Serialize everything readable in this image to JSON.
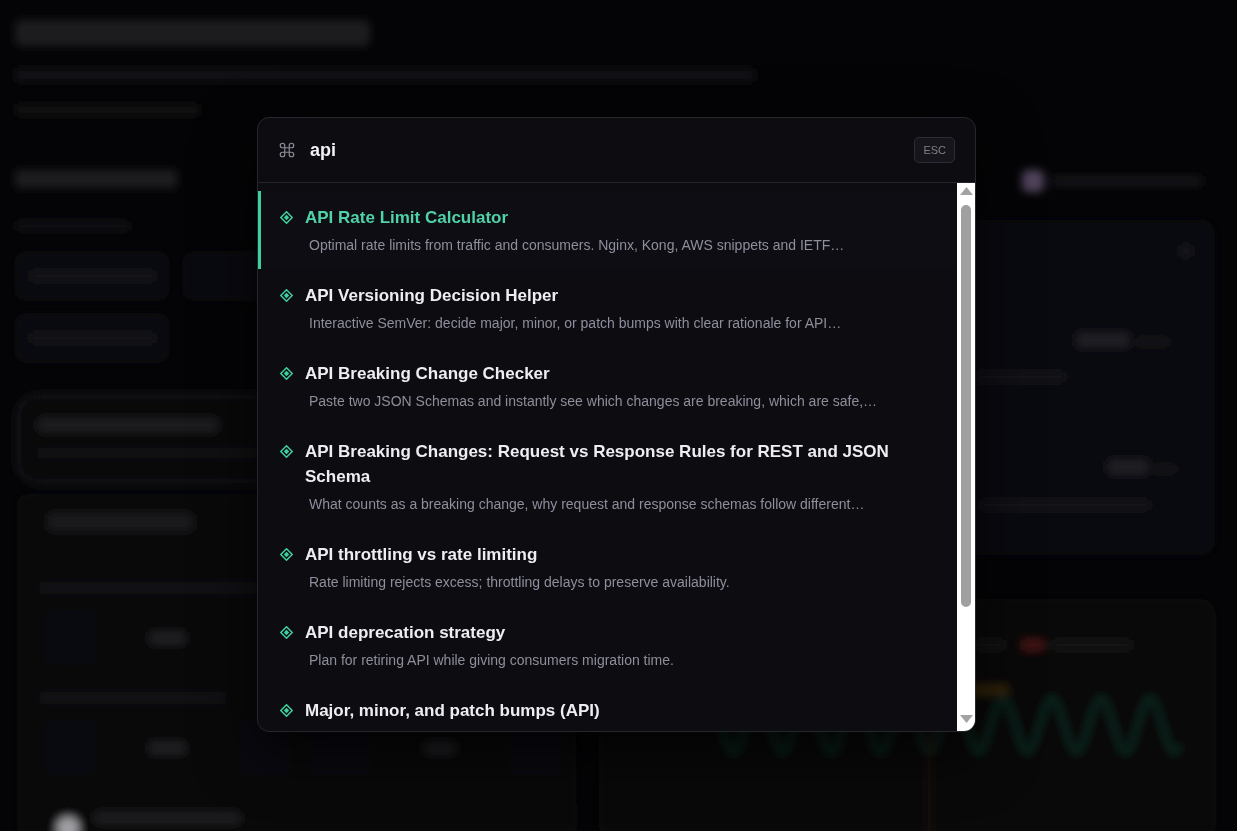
{
  "search": {
    "value": "api",
    "esc_hint": "ESC"
  },
  "results": [
    {
      "title": "API Rate Limit Calculator",
      "description": "Optimal rate limits from traffic and consumers. Nginx, Kong, AWS snippets and IETF…",
      "selected": true
    },
    {
      "title": "API Versioning Decision Helper",
      "description": "Interactive SemVer: decide major, minor, or patch bumps with clear rationale for API…",
      "selected": false
    },
    {
      "title": "API Breaking Change Checker",
      "description": "Paste two JSON Schemas and instantly see which changes are breaking, which are safe,…",
      "selected": false
    },
    {
      "title": "API Breaking Changes: Request vs Response Rules for REST and JSON Schema",
      "description": "What counts as a breaking change, why request and response schemas follow different…",
      "selected": false
    },
    {
      "title": "API throttling vs rate limiting",
      "description": "Rate limiting rejects excess; throttling delays to preserve availability.",
      "selected": false
    },
    {
      "title": "API deprecation strategy",
      "description": "Plan for retiring API while giving consumers migration time.",
      "selected": false
    },
    {
      "title": "Major, minor, and patch bumps (API)",
      "selected": false
    }
  ]
}
